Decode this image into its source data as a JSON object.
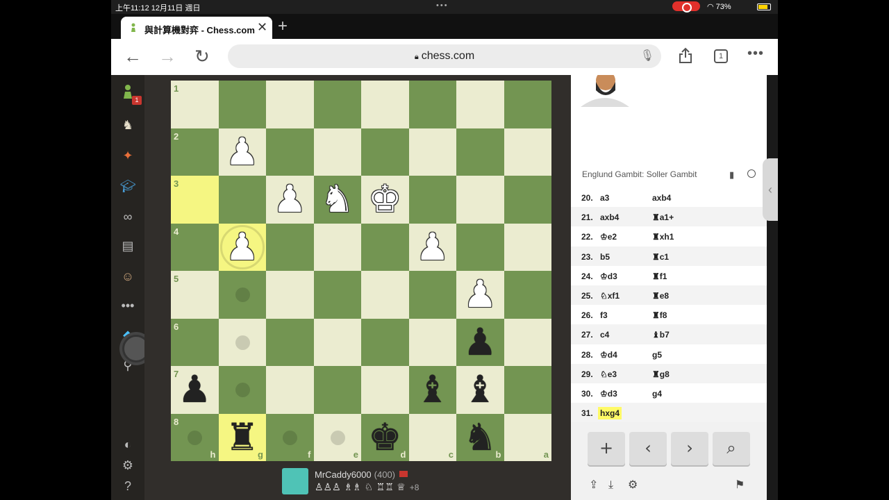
{
  "status": {
    "time": "上午11:12 12月11日 週日",
    "battery": "73%"
  },
  "tab": {
    "title": "與計算機對弈 - Chess.com",
    "close": "✕",
    "new": "+"
  },
  "address": {
    "url": "chess.com",
    "tab_count": "1"
  },
  "sidebar": {
    "notification_badge": "1"
  },
  "board": {
    "files": [
      "h",
      "g",
      "f",
      "e",
      "d",
      "c",
      "b",
      "a"
    ],
    "ranks": [
      "1",
      "2",
      "3",
      "4",
      "5",
      "6",
      "7",
      "8"
    ],
    "pieces": [
      {
        "sq": "g2",
        "glyph": "♟",
        "color": "white"
      },
      {
        "sq": "f3",
        "glyph": "♟",
        "color": "white"
      },
      {
        "sq": "e3",
        "glyph": "♞",
        "color": "white"
      },
      {
        "sq": "d3",
        "glyph": "♚",
        "color": "white"
      },
      {
        "sq": "g4",
        "glyph": "♟",
        "color": "white"
      },
      {
        "sq": "c4",
        "glyph": "♟",
        "color": "white"
      },
      {
        "sq": "b5",
        "glyph": "♟",
        "color": "white"
      },
      {
        "sq": "b6",
        "glyph": "♟",
        "color": "black"
      },
      {
        "sq": "h7",
        "glyph": "♟",
        "color": "black"
      },
      {
        "sq": "c7",
        "glyph": "♝",
        "color": "black"
      },
      {
        "sq": "b7",
        "glyph": "♝",
        "color": "black"
      },
      {
        "sq": "g8",
        "glyph": "♜",
        "color": "black"
      },
      {
        "sq": "d8",
        "glyph": "♚",
        "color": "black"
      },
      {
        "sq": "b8",
        "glyph": "♞",
        "color": "black"
      }
    ],
    "highlights": [
      "h3",
      "g4",
      "g8"
    ],
    "move_dots": [
      "g5",
      "g6",
      "g7",
      "h8",
      "f8",
      "e8"
    ],
    "selected": "g4"
  },
  "player": {
    "name": "MrCaddy6000",
    "rating": "(400)",
    "captured": "♙♙♙ ♗♗ ♘ ♖♖ ♕",
    "advantage": "+8"
  },
  "panel": {
    "opening": "Englund Gambit: Soller Gambit",
    "moves": [
      {
        "n": "20.",
        "w": "a3",
        "b": "axb4"
      },
      {
        "n": "21.",
        "w": "axb4",
        "b": "♜a1+"
      },
      {
        "n": "22.",
        "w": "♔e2",
        "b": "♜xh1"
      },
      {
        "n": "23.",
        "w": "b5",
        "b": "♜c1"
      },
      {
        "n": "24.",
        "w": "♔d3",
        "b": "♜f1"
      },
      {
        "n": "25.",
        "w": "♘xf1",
        "b": "♜e8"
      },
      {
        "n": "26.",
        "w": "f3",
        "b": "♜f8"
      },
      {
        "n": "27.",
        "w": "c4",
        "b": "♝b7"
      },
      {
        "n": "28.",
        "w": "♔d4",
        "b": "g5"
      },
      {
        "n": "29.",
        "w": "♘e3",
        "b": "♜g8"
      },
      {
        "n": "30.",
        "w": "♔d3",
        "b": "g4"
      },
      {
        "n": "31.",
        "w": "hxg4",
        "b": ""
      }
    ],
    "controls": [
      "+",
      "‹",
      "›",
      "⌕"
    ]
  },
  "colors": {
    "light": "#ebecd0",
    "dark": "#739552",
    "highlight": "#f5f682"
  }
}
